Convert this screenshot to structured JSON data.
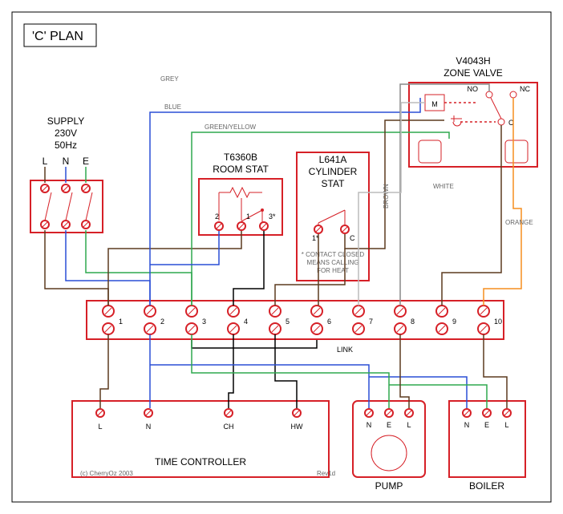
{
  "title": "'C' PLAN",
  "supply": {
    "label": "SUPPLY",
    "voltage": "230V",
    "freq": "50Hz",
    "L": "L",
    "N": "N",
    "E": "E"
  },
  "roomstat": {
    "label1": "T6360B",
    "label2": "ROOM STAT",
    "t1": "2",
    "t2": "1",
    "t3": "3*"
  },
  "cylstat": {
    "label1": "L641A",
    "label2": "CYLINDER",
    "label3": "STAT",
    "t1": "1*",
    "t2": "C",
    "note1": "* CONTACT CLOSED",
    "note2": "MEANS CALLING",
    "note3": "FOR HEAT"
  },
  "zone": {
    "label1": "V4043H",
    "label2": "ZONE VALVE",
    "M": "M",
    "NO": "NO",
    "NC": "NC",
    "C": "C"
  },
  "junction": {
    "t1": "1",
    "t2": "2",
    "t3": "3",
    "t4": "4",
    "t5": "5",
    "t6": "6",
    "t7": "7",
    "t8": "8",
    "t9": "9",
    "t10": "10",
    "link": "LINK"
  },
  "timectl": {
    "label": "TIME CONTROLLER",
    "L": "L",
    "N": "N",
    "CH": "CH",
    "HW": "HW"
  },
  "pump": {
    "label": "PUMP",
    "N": "N",
    "E": "E",
    "L": "L"
  },
  "boiler": {
    "label": "BOILER",
    "N": "N",
    "E": "E",
    "L": "L"
  },
  "wirecolor": {
    "grey": "GREY",
    "blue": "BLUE",
    "gy": "GREEN/YELLOW",
    "brown": "BROWN",
    "white": "WHITE",
    "orange": "ORANGE"
  },
  "meta": {
    "copyright": "(c) CherryOz 2003",
    "rev": "Rev1d"
  }
}
